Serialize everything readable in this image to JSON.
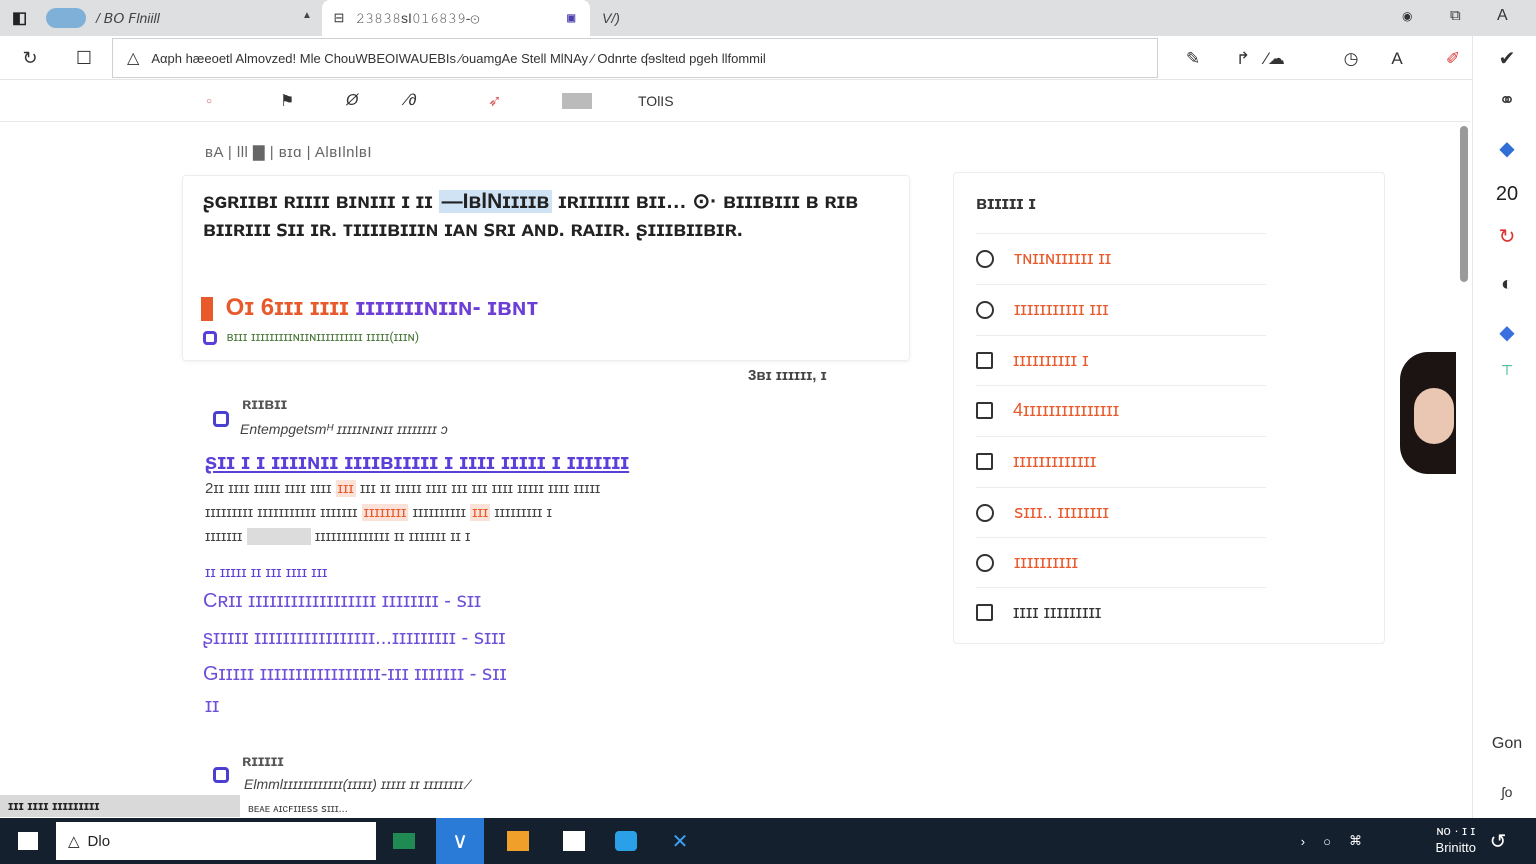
{
  "browser": {
    "tabs": [
      {
        "label": "/ 𝘉𝘖 𝘍lniill"
      },
      {
        "label": "𝟸𝟹𝟾𝟹𝟾sI𝟶𝟷𝟼𝟾𝟹𝟿-⊙"
      },
      {
        "label": "V/)"
      }
    ],
    "address": "Aαph hæeoetl Almovzed! Mle ChouWBEOIWAUEBIs ∕ouamgAe Stell MlNAy ∕ Odnrte ʠɘslteɩd pgeh llfommil"
  },
  "toolbar": {
    "tools_label": "TOlIS"
  },
  "content": {
    "breadcrumb": "ʙA | lll ▇ | ʙɪɑ | AlʙIlnlʙI",
    "card": {
      "title_a": "ʂɢʀɪɪʙɪ ʀɪɪɪɪ ʙɪɴɪɪɪ ɪ ɪɪ",
      "title_hl": "—IʙlNɪɪɪɪʙ",
      "title_b": "ɪʀɪɪɪɪɪɪ ʙɪɪ… ⊙· ʙɪɪɪʙɪɪɪ ʙ ʀɪʙ ʙɪɪʀɪɪɪ ꜱɪɪ ɪʀ. ᴛɪɪɪɪʙɪɪɪɴ ɪᴀɴ ꜱʀɪ ᴀɴᴅ. ʀᴀɪɪʀ. ʂɪɪɪʙɪɪʙɪʀ.",
      "heading_a": "Oɪ 6ɪɪɪ ɪɪɪɪ",
      "heading_b": "ɪɪɪɪɪɪɪɴɪɪɴ- ɪʙɴᴛ",
      "sub": "ʙɪɪɪ ɪɪɪɪɪɪɪɪɪɴɪɪɴɪɪɪɪɪɪɪɪɪɪ ɪɪɪɪɪ(ɪɪɪɴ)"
    },
    "meta_right": "3ʙɪ ɪɪɪɪɪɪ, ɪ",
    "section1": {
      "label": "ʀɪɪʙɪɪ",
      "sub": "Entempgetsmᴴ ɪɪɪɪɪɴɪɴɪɪ ɪɪɪɪɪɪɪɪ ↄ",
      "link": "ʂɪɪ ɪ ɪ   ɪɪɪɪɴɪɪ ɪɪɪɪʙɪɪɪɪɪ ɪ ɪɪɪɪ ɪɪɪɪɪ ɪ   ɪɪɪɪɪɪɪ",
      "line1_a": "2ɪɪ ɪɪɪɪ ɪɪɪɪɪ   ɪɪɪɪ ɪɪɪɪ",
      "line1_red": "ɪɪɪ",
      "line1_b": "ɪɪɪ ɪɪ ɪɪɪɪɪ ɪɪɪɪ ɪɪɪ ɪɪɪ ɪɪɪɪ ɪɪɪɪɪ ɪɪɪɪ ɪɪɪɪɪ",
      "line2_a": "ɪɪɪɪɪɪɪɪɪ ɪɪɪɪɪɪɪɪɪɪɪ ɪɪɪɪɪɪɪ",
      "line2_red": "ɪɪɪɪɪɪɪɪ",
      "line2_b": "ɪɪɪɪɪɪɪɪɪɪ",
      "line2_red2": "ɪɪɪ",
      "line2_c": "ɪɪɪɪɪɪɪɪɪ ɪ",
      "line3_a": "ɪɪɪɪɪɪɪ",
      "line3_b": "ɪɪɪɪɪɪɪɪɪɪɪɪɪɪ ɪɪ ɪɪɪɪɪɪɪ ɪɪ ɪ",
      "sublink": "ɪɪ ɪɪɪɪɪ ɪɪ ɪɪɪ ɪɪɪɪ ɪɪɪ",
      "purple_lines": [
        "Cʀɪɪ ɪɪɪɪɪɪɪɪɪɪɪɪɪɪɪɪɪɪ   ɪɪɪɪɪɪɪɪ - ꜱɪɪ",
        "ʂɪɪɪɪɪ ɪɪɪɪɪɪɪɪɪɪɪɪɪɪɪɪɪ...ɪɪɪɪɪɪɪɪɪ - ꜱɪɪɪ",
        "Gɪɪɪɪɪ ɪɪɪɪɪɪɪɪɪɪɪɪɪɪɪɪɪ-ɪɪɪ ɪɪɪɪɪɪɪ - ꜱɪɪ",
        "ɪɪ"
      ]
    },
    "section2": {
      "label": "ʀɪɪɪɪɪ",
      "sub": "Elmmlɪɪɪɪɪɪɪɪɪɪɪɪ(ɪɪɪɪɪ) ɪɪɪɪɪ ɪɪ ɪɪɪɪɪɪɪɪ ⁄",
      "sub2": "ʙᴇᴀᴇ ᴀɪᴄꜰɪɪᴇꜱꜱ ꜱɪɪɪ..."
    }
  },
  "panel": {
    "title": "ʙɪɪɪɪɪ ɪ",
    "options": [
      {
        "type": "radio",
        "label": "ᴛɴɪɪɴɪɪɪɪɪɪ ɪɪ",
        "color": "#e8592c"
      },
      {
        "type": "radio",
        "label": "ɪɪɪɪɪɪɪɪɪɪɪ ɪɪɪ",
        "color": "#e8592c"
      },
      {
        "type": "check",
        "label": "ɪɪɪɪɪɪɪɪɪɪ ɪ",
        "color": "#e8592c"
      },
      {
        "type": "check",
        "label": "4ɪɪɪɪɪɪɪɪɪɪɪɪɪɪɪ",
        "color": "#e8592c"
      },
      {
        "type": "check",
        "label": "ɪɪɪɪɪɪɪɪɪɪɪɪɪ",
        "color": "#e8592c"
      },
      {
        "type": "radio",
        "label": "ꜱɪɪɪ.. ɪɪɪɪɪɪɪɪ",
        "color": "#e8592c"
      },
      {
        "type": "radio",
        "label": "ɪɪɪɪɪɪɪɪɪɪ",
        "color": "#e8592c"
      },
      {
        "type": "check",
        "label": "ɪɪɪɪ ɪɪɪɪɪɪɪɪɪ",
        "color": "#333333"
      }
    ]
  },
  "rail": {
    "count": "20",
    "bottom_label": "Gon",
    "bottom_sub": "ʃo"
  },
  "bottom_strip": "ɪɪɪ ɪɪɪɪ ɪɪɪɪɪɪɪɪɪ",
  "taskbar": {
    "search_text": "Dlo",
    "clock_line1": "ɴᴏ · ɪ ɪ",
    "clock_line2": "Brinitto"
  },
  "colors": {
    "accent_purple": "#5b3fd8",
    "accent_orange": "#e8592c",
    "taskbar": "#15202e"
  }
}
